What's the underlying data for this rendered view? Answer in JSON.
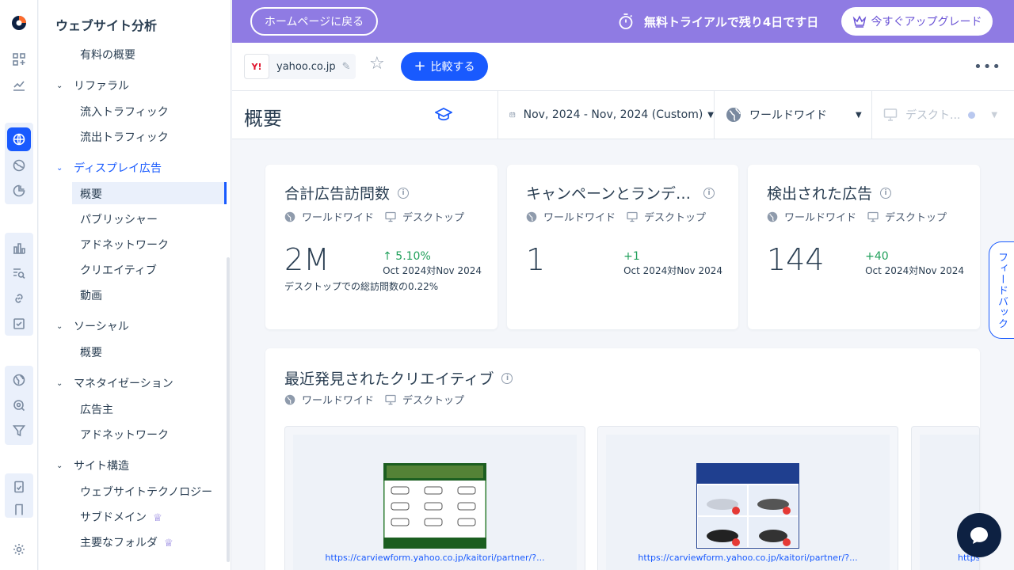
{
  "sidebar": {
    "title": "ウェブサイト分析",
    "items": [
      {
        "label": "有料の概要"
      },
      {
        "label": "リファラル"
      },
      {
        "label": "流入トラフィック"
      },
      {
        "label": "流出トラフィック"
      },
      {
        "label": "ディスプレイ広告"
      },
      {
        "label": "概要"
      },
      {
        "label": "パブリッシャー"
      },
      {
        "label": "アドネットワーク"
      },
      {
        "label": "クリエイティブ"
      },
      {
        "label": "動画"
      },
      {
        "label": "ソーシャル"
      },
      {
        "label": "概要"
      },
      {
        "label": "マネタイゼーション"
      },
      {
        "label": "広告主"
      },
      {
        "label": "アドネットワーク"
      },
      {
        "label": "サイト構造"
      },
      {
        "label": "ウェブサイトテクノロジー"
      },
      {
        "label": "サブドメイン"
      },
      {
        "label": "主要なフォルダ"
      }
    ]
  },
  "banner": {
    "home_label": "ホームページに戻る",
    "trial_text": "無料トライアルで残り4日です日",
    "upgrade_label": "今すぐアップグレード"
  },
  "domain_bar": {
    "favicon_text": "Y!",
    "domain": "yahoo.co.jp",
    "compare_label": "比較する"
  },
  "header": {
    "title": "概要",
    "date_range": "Nov, 2024 - Nov, 2024 (Custom)",
    "region": "ワールドワイド",
    "device": "デスクト..."
  },
  "metrics": [
    {
      "title": "合計広告訪問数",
      "region": "ワールドワイド",
      "device": "デスクトップ",
      "value": "2M",
      "change": "↑ 5.10%",
      "compare": "Oct 2024対Nov 2024",
      "footnote": "デスクトップでの総訪問数の0.22%"
    },
    {
      "title": "キャンペーンとランデ…",
      "region": "ワールドワイド",
      "device": "デスクトップ",
      "value": "1",
      "change": "+1",
      "compare": "Oct 2024対Nov 2024"
    },
    {
      "title": "検出された広告",
      "region": "ワールドワイド",
      "device": "デスクトップ",
      "value": "144",
      "change": "+40",
      "compare": "Oct 2024対Nov 2024"
    }
  ],
  "creatives": {
    "title": "最近発見されたクリエイティブ",
    "region": "ワールドワイド",
    "device": "デスクトップ",
    "items": [
      {
        "url": "https://carviewform.yahoo.co.jp/kaitori/partner/?..."
      },
      {
        "url": "https://carviewform.yahoo.co.jp/kaitori/partner/?..."
      },
      {
        "url": "https"
      }
    ]
  },
  "feedback_label": "フィードバック",
  "colors": {
    "accent": "#195afe",
    "banner": "#8f7be3",
    "positive": "#21a05b"
  }
}
